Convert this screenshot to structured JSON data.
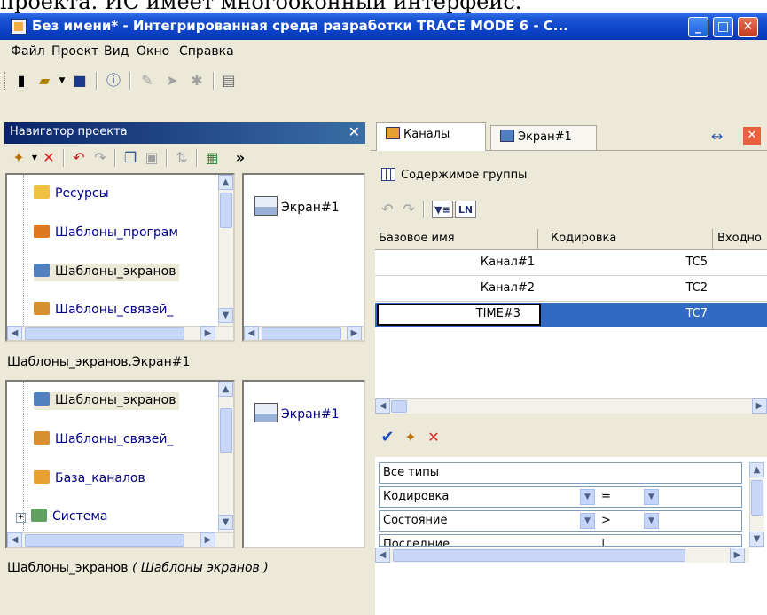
{
  "above_text": "проекта. ИС имеет многооконный интерфейс.",
  "window": {
    "title": "Без имени* - Интегрированная среда разработки TRACE MODE 6 - C...",
    "buttons": {
      "minimize": "_",
      "maximize": "□",
      "close": "✕"
    }
  },
  "menu": [
    "Файл",
    "Проект",
    "Вид",
    "Окно",
    "Справка"
  ],
  "nav": {
    "title": "Навигатор проекта",
    "close": "✕",
    "more": "»",
    "top_tree": [
      "Ресурсы",
      "Шаблоны_програм",
      "Шаблоны_экранов",
      "Шаблоны_связей_"
    ],
    "top_screen": "Экран#1",
    "path": "Шаблоны_экранов.Экран#1",
    "bottom_tree": [
      "Шаблоны_экранов",
      "Шаблоны_связей_",
      "База_каналов",
      "Система"
    ],
    "bottom_screen": "Экран#1",
    "bottom_path_prefix": "Шаблоны_экранов ",
    "bottom_path_italic": "( Шаблоны экранов )"
  },
  "tabs": {
    "channels": "Каналы",
    "screen": "Экран#1",
    "arrows": "↔",
    "close": "✕"
  },
  "group": {
    "label": "Содержимое группы"
  },
  "grid": {
    "headers": [
      "Базовое имя",
      "Кодировка",
      "Входно"
    ],
    "rows": [
      {
        "name": "Канал#1",
        "code": "TC5"
      },
      {
        "name": "Канал#2",
        "code": "TC2"
      },
      {
        "name": "TIME#3",
        "code": "TC7"
      }
    ]
  },
  "filters": {
    "all_types": "Все типы",
    "rows": [
      {
        "field": "Кодировка",
        "op": "="
      },
      {
        "field": "Состояние",
        "op": ">"
      },
      {
        "field": "Последние",
        "op": "|"
      }
    ]
  },
  "colors": {
    "titlebar": "#0a40c5",
    "selection": "#316ac5",
    "face": "#ece9d8"
  }
}
